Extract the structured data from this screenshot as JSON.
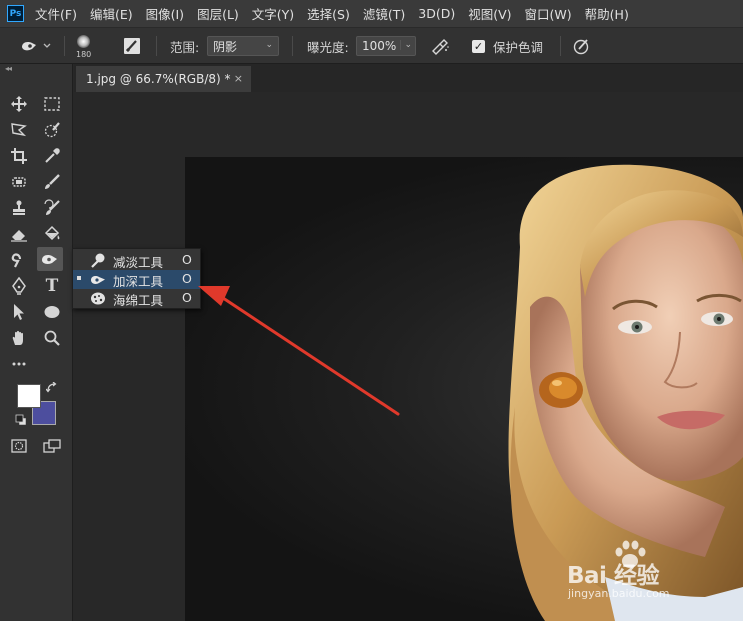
{
  "app": {
    "logo": "Ps"
  },
  "menu": [
    "文件(F)",
    "编辑(E)",
    "图像(I)",
    "图层(L)",
    "文字(Y)",
    "选择(S)",
    "滤镜(T)",
    "3D(D)",
    "视图(V)",
    "窗口(W)",
    "帮助(H)"
  ],
  "options": {
    "brush_size": "180",
    "range_label": "范围:",
    "range_value": "阴影",
    "exposure_label": "曝光度:",
    "exposure_value": "100%",
    "protect_tones_label": "保护色调",
    "protect_tones_checked": true
  },
  "toolbar": {
    "collapse_glyph": "◂◂",
    "type_tool_glyph": "T",
    "foreground_color": "#ffffff",
    "background_color": "#4d4e9e"
  },
  "document": {
    "tab_title": "1.jpg @ 66.7%(RGB/8) *",
    "close_glyph": "×"
  },
  "flyout": [
    {
      "label": "减淡工具",
      "shortcut": "O",
      "icon": "dodge-icon",
      "selected": false
    },
    {
      "label": "加深工具",
      "shortcut": "O",
      "icon": "burn-icon",
      "selected": true
    },
    {
      "label": "海绵工具",
      "shortcut": "O",
      "icon": "sponge-icon",
      "selected": false
    }
  ],
  "annotation": {
    "arrow_color": "#e0392b"
  },
  "watermark": {
    "brand": "Bai 经验",
    "url": "jingyan.baidu.com"
  }
}
